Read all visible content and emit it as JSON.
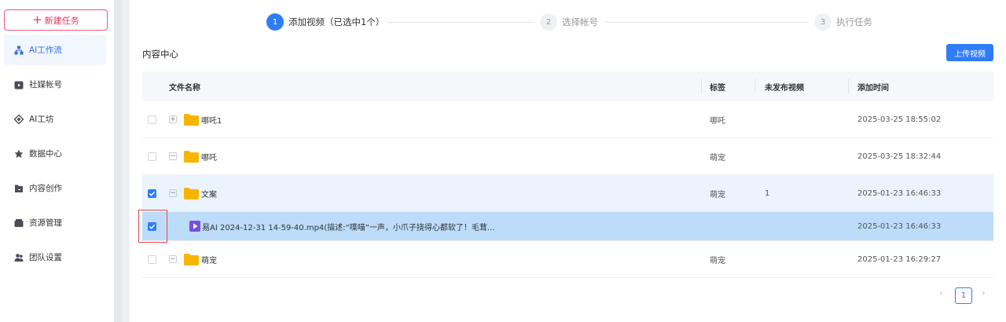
{
  "sidebar": {
    "new_task": "新建任务",
    "items": [
      {
        "label": "AI工作流",
        "icon": "workflow-icon",
        "active": true
      },
      {
        "label": "社媒帐号",
        "icon": "media-account-icon",
        "active": false
      },
      {
        "label": "AI工坊",
        "icon": "ai-workshop-icon",
        "active": false
      },
      {
        "label": "数据中心",
        "icon": "data-center-icon",
        "active": false
      },
      {
        "label": "内容创作",
        "icon": "content-creation-icon",
        "active": false
      },
      {
        "label": "资源管理",
        "icon": "resource-management-icon",
        "active": false
      },
      {
        "label": "团队设置",
        "icon": "team-settings-icon",
        "active": false
      }
    ]
  },
  "steps": [
    {
      "num": "1",
      "label": "添加视频（已选中1个）",
      "active": true
    },
    {
      "num": "2",
      "label": "选择帐号",
      "active": false
    },
    {
      "num": "3",
      "label": "执行任务",
      "active": false
    }
  ],
  "content": {
    "title": "内容中心",
    "upload_label": "上传视频"
  },
  "table": {
    "headers": {
      "name": "文件名称",
      "tag": "标签",
      "unpublished": "未发布视频",
      "added": "添加时间"
    },
    "rows": [
      {
        "type": "folder",
        "expand": "+",
        "name": "哪吒1",
        "tag": "哪吒",
        "unpublished": "",
        "added": "2025-03-25 18:55:02",
        "checked": false
      },
      {
        "type": "folder",
        "expand": "−",
        "name": "哪吒",
        "tag": "萌宠",
        "unpublished": "",
        "added": "2025-03-25 18:32:44",
        "checked": false
      },
      {
        "type": "folder",
        "expand": "−",
        "name": "文案",
        "tag": "萌宠",
        "unpublished": "1",
        "added": "2025-01-23 16:46:33",
        "checked": true
      },
      {
        "type": "video",
        "expand": "",
        "name": "易AI 2024-12-31 14-59-40.mp4(描述:“喋喵”一声，小爪子挠得心都软了！毛茸...",
        "tag": "",
        "unpublished": "",
        "added": "2025-01-23 16:46:33",
        "checked": true
      },
      {
        "type": "folder",
        "expand": "−",
        "name": "萌宠",
        "tag": "萌宠",
        "unpublished": "",
        "added": "2025-01-23 16:29:27",
        "checked": false
      }
    ]
  },
  "pagination": {
    "prev": "‹",
    "current": "1",
    "next": "›"
  },
  "colors": {
    "accent": "#2f7cf6",
    "new_task": "#e8365d",
    "folder": "#f7b500",
    "video": "#7a4fe0"
  }
}
